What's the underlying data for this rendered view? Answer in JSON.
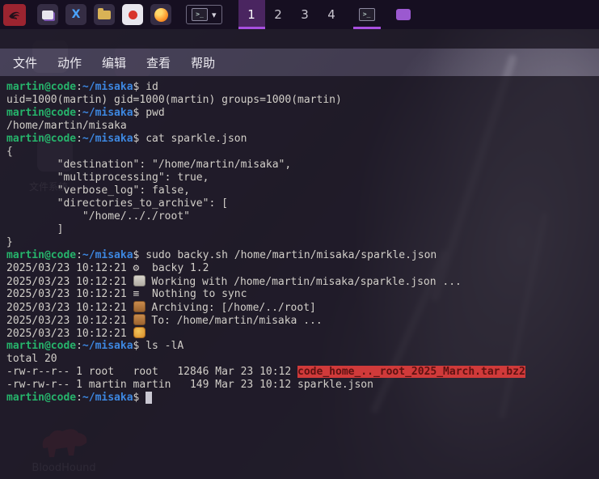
{
  "colors": {
    "panel_bg": "#160f21",
    "accent_purple": "#a84fe0",
    "prompt_user_green": "#26b36b",
    "prompt_path_blue": "#3d87e0",
    "archive_file_red": "#d03a3a",
    "terminal_bg": "#1e1926"
  },
  "panel": {
    "workspaces": [
      "1",
      "2",
      "3",
      "4"
    ],
    "active_workspace": "1"
  },
  "menubar": {
    "items": [
      "文件",
      "动作",
      "编辑",
      "查看",
      "帮助"
    ]
  },
  "desktop": {
    "file_system_label": "文件系统",
    "bloodhound_label": "BloodHound"
  },
  "terminal": {
    "lines": [
      [
        {
          "t": "martin@code",
          "s": "u"
        },
        {
          "t": ":"
        },
        {
          "t": "~/misaka",
          "s": "p"
        },
        {
          "t": "$ id"
        }
      ],
      [
        {
          "t": "uid=1000(martin) gid=1000(martin) groups=1000(martin)"
        }
      ],
      [
        {
          "t": "martin@code",
          "s": "u"
        },
        {
          "t": ":"
        },
        {
          "t": "~/misaka",
          "s": "p"
        },
        {
          "t": "$ pwd"
        }
      ],
      [
        {
          "t": "/home/martin/misaka"
        }
      ],
      [
        {
          "t": "martin@code",
          "s": "u"
        },
        {
          "t": ":"
        },
        {
          "t": "~/misaka",
          "s": "p"
        },
        {
          "t": "$ cat sparkle.json"
        }
      ],
      [
        {
          "t": "{"
        }
      ],
      [
        {
          "t": "        \"destination\": \"/home/martin/misaka\","
        }
      ],
      [
        {
          "t": "        \"multiprocessing\": true,"
        }
      ],
      [
        {
          "t": "        \"verbose_log\": false,"
        }
      ],
      [
        {
          "t": "        \"directories_to_archive\": ["
        }
      ],
      [
        {
          "t": "            \"/home/.././root\""
        }
      ],
      [
        {
          "t": "        ]"
        }
      ],
      [
        {
          "t": "}"
        }
      ],
      [
        {
          "t": "martin@code",
          "s": "u"
        },
        {
          "t": ":"
        },
        {
          "t": "~/misaka",
          "s": "p"
        },
        {
          "t": "$ sudo backy.sh /home/martin/misaka/sparkle.json"
        }
      ],
      [
        {
          "t": "2025/03/23 10:12:21 ⚙  backy 1.2"
        }
      ],
      [
        {
          "t": "2025/03/23 10:12:21 "
        },
        {
          "t": "📋",
          "s": "chip-clip"
        },
        {
          "t": " Working with /home/martin/misaka/sparkle.json ..."
        }
      ],
      [
        {
          "t": "2025/03/23 10:12:21 ≡  Nothing to sync"
        }
      ],
      [
        {
          "t": "2025/03/23 10:12:21 "
        },
        {
          "t": "📦",
          "s": "chip-box"
        },
        {
          "t": " Archiving: [/home/../root]"
        }
      ],
      [
        {
          "t": "2025/03/23 10:12:21 "
        },
        {
          "t": "📦",
          "s": "chip-box"
        },
        {
          "t": " To: /home/martin/misaka ..."
        }
      ],
      [
        {
          "t": "2025/03/23 10:12:21 "
        },
        {
          "t": "🍺",
          "s": "chip-beer"
        }
      ],
      [
        {
          "t": "martin@code",
          "s": "u"
        },
        {
          "t": ":"
        },
        {
          "t": "~/misaka",
          "s": "p"
        },
        {
          "t": "$ ls -lA"
        }
      ],
      [
        {
          "t": "total 20"
        }
      ],
      [
        {
          "t": "-rw-r--r-- 1 root   root   12846 Mar 23 10:12 "
        },
        {
          "t": "code_home_.._root_2025_March.tar.bz2",
          "s": "red"
        }
      ],
      [
        {
          "t": "-rw-rw-r-- 1 martin martin   149 Mar 23 10:12 sparkle.json"
        }
      ],
      [
        {
          "t": "martin@code",
          "s": "u"
        },
        {
          "t": ":"
        },
        {
          "t": "~/misaka",
          "s": "p"
        },
        {
          "t": "$ "
        },
        {
          "t": " ",
          "s": "cur"
        }
      ]
    ]
  }
}
